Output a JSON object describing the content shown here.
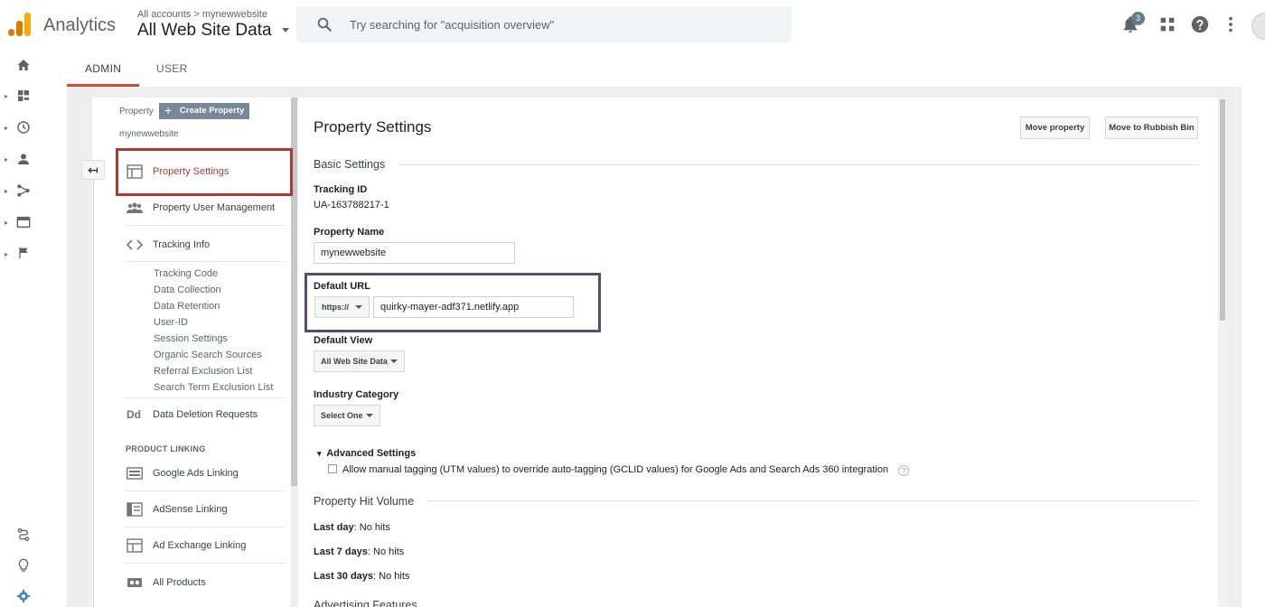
{
  "header": {
    "app_title": "Analytics",
    "account_crumb": "All accounts > mynewwebsite",
    "view_name": "All Web Site Data",
    "search_placeholder": "Try searching for \"acquisition overview\"",
    "notification_count": "3"
  },
  "tabs": [
    {
      "label": "ADMIN",
      "active": true
    },
    {
      "label": "USER",
      "active": false
    }
  ],
  "left_panel": {
    "property_label": "Property",
    "create_property_label": "Create Property",
    "property_name": "mynewwebsite",
    "nav": [
      {
        "label": "Property Settings",
        "icon": "layout-icon",
        "active": true
      },
      {
        "label": "Property User Management",
        "icon": "people-icon"
      },
      {
        "label": "Tracking Info",
        "icon": "code-icon"
      }
    ],
    "tracking_sub": [
      "Tracking Code",
      "Data Collection",
      "Data Retention",
      "User-ID",
      "Session Settings",
      "Organic Search Sources",
      "Referral Exclusion List",
      "Search Term Exclusion List"
    ],
    "data_deletion": {
      "label": "Data Deletion Requests",
      "icon_text": "Dd"
    },
    "section_product_linking": "PRODUCT LINKING",
    "product_links": [
      {
        "label": "Google Ads Linking",
        "icon": "ads-icon"
      },
      {
        "label": "AdSense Linking",
        "icon": "adsense-icon"
      },
      {
        "label": "Ad Exchange Linking",
        "icon": "adexchange-icon"
      },
      {
        "label": "All Products",
        "icon": "products-icon"
      }
    ]
  },
  "main": {
    "title": "Property Settings",
    "move_property_label": "Move property",
    "rubbish_bin_label": "Move to Rubbish Bin",
    "basic_settings": "Basic Settings",
    "tracking_id_label": "Tracking ID",
    "tracking_id": "UA-163788217-1",
    "property_name_label": "Property Name",
    "property_name_value": "mynewwebsite",
    "default_url_label": "Default URL",
    "url_protocol": "https://",
    "url_value": "quirky-mayer-adf371.netlify.app",
    "default_view_label": "Default View",
    "default_view_value": "All Web Site Data",
    "industry_label": "Industry Category",
    "industry_value": "Select One",
    "advanced_label": "Advanced Settings",
    "advanced_toggle_glyph": "▾",
    "manual_tagging_text": "Allow manual tagging (UTM values) to override auto-tagging (GCLID values) for Google Ads and Search Ads 360 integration",
    "help_glyph": "?",
    "hit_volume_title": "Property Hit Volume",
    "hits": [
      {
        "label": "Last day",
        "value": ": No hits"
      },
      {
        "label": "Last 7 days",
        "value": ": No hits"
      },
      {
        "label": "Last 30 days",
        "value": ": No hits"
      }
    ],
    "advertising_features": "Advertising Features"
  },
  "colors": {
    "accent_red": "#d5452c",
    "highlight_red": "#b03a2e",
    "highlight_purple": "#5c4a70",
    "create_button": "#778899"
  }
}
